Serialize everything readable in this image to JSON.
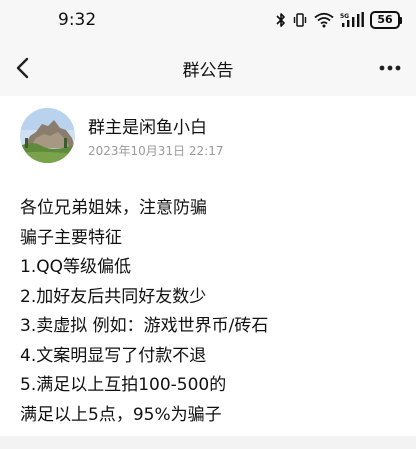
{
  "status_bar": {
    "time": "9:32",
    "icons": [
      "bluetooth-icon",
      "vibrate-icon",
      "wifi-icon",
      "5g-signal-icon"
    ],
    "battery": "56"
  },
  "nav": {
    "title": "群公告",
    "back_icon": "chevron-left-icon",
    "more_icon": "more-dots-icon"
  },
  "poster": {
    "name": "群主是闲鱼小白",
    "date": "2023年10月31日 22:17"
  },
  "notice": {
    "lines": [
      "各位兄弟姐妹，注意防骗",
      "骗子主要特征",
      "1.QQ等级偏低",
      "2.加好友后共同好友数少",
      "3.卖虚拟 例如：游戏世界币/砖石",
      "4.文案明显写了付款不退",
      "5.满足以上互拍100-500的",
      "满足以上5点，95%为骗子"
    ]
  }
}
